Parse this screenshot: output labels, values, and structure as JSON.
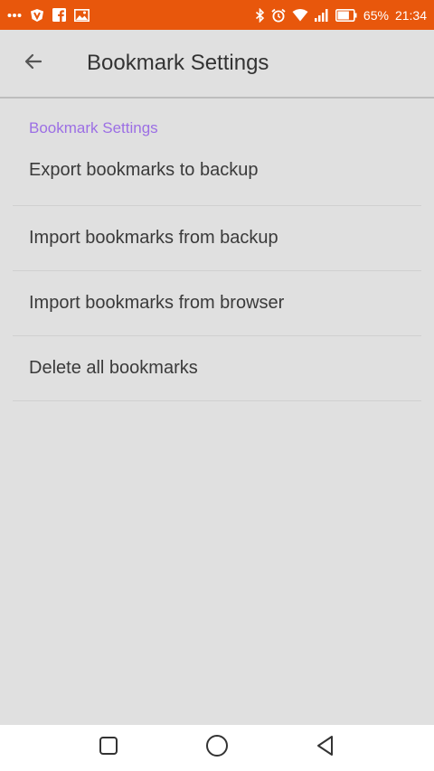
{
  "status_bar": {
    "battery_percent": "65%",
    "time": "21:34",
    "color": "#e8570c",
    "left_icons": [
      "more-icon",
      "vpn-shield-icon",
      "facebook-icon",
      "gallery-icon"
    ],
    "right_icons": [
      "bluetooth-icon",
      "alarm-icon",
      "wifi-icon",
      "signal-icon",
      "battery-icon"
    ]
  },
  "app_bar": {
    "title": "Bookmark Settings",
    "back_icon": "back-arrow-icon"
  },
  "section": {
    "header": "Bookmark Settings",
    "accent_color": "#9c6fe4",
    "items": [
      {
        "label": "Export bookmarks to backup"
      },
      {
        "label": "Import bookmarks from backup"
      },
      {
        "label": "Import bookmarks from browser"
      },
      {
        "label": "Delete all bookmarks"
      }
    ]
  },
  "nav_bar": {
    "buttons": [
      "recents-square-icon",
      "home-circle-icon",
      "back-triangle-icon"
    ]
  }
}
